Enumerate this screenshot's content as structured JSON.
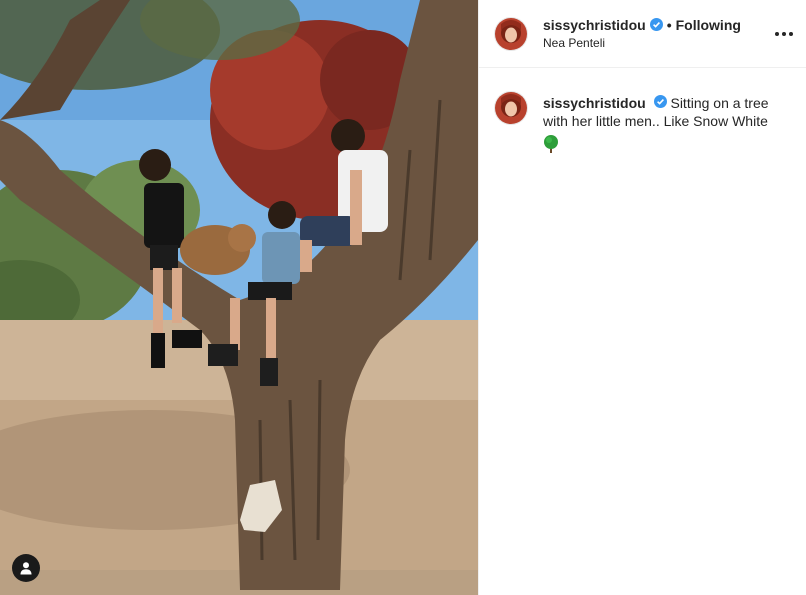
{
  "header": {
    "username": "sissychristidou",
    "separator": "•",
    "follow_status": "Following",
    "location": "Nea Penteli",
    "more_icon": "more-horizontal-icon"
  },
  "caption": {
    "username": "sissychristidou",
    "text": "Sitting on a tree with her little men.. Like Snow White",
    "emoji_icon": "deciduous-tree-emoji"
  },
  "media": {
    "tag_icon": "user-tag-icon"
  },
  "colors": {
    "verified_blue": "#3897f0",
    "divider": "#efefef",
    "text": "#262626"
  }
}
